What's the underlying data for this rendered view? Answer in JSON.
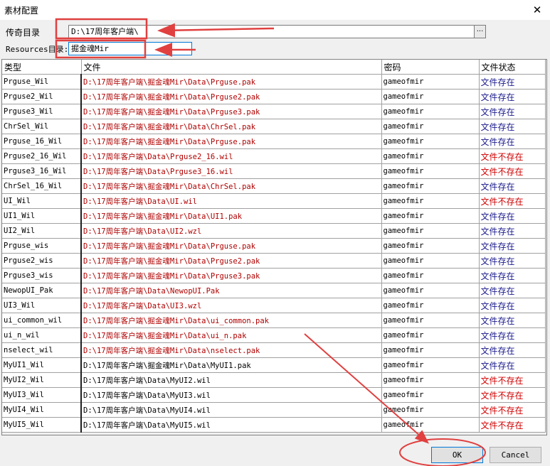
{
  "window": {
    "title": "素材配置",
    "close_label": "✕"
  },
  "form": {
    "legend_dir_label": "传奇目录",
    "legend_dir_value": "D:\\17周年客户端\\",
    "browse_label": "...",
    "resources_dir_label": "Resources目录:",
    "resources_dir_value": "掘金魂Mir"
  },
  "table": {
    "columns": [
      "类型",
      "文件",
      "密码",
      "文件状态"
    ],
    "rows": [
      {
        "type": "Prguse_Wil",
        "file": "D:\\17周年客户端\\掘金魂Mir\\Data\\Prguse.pak",
        "password": "gameofmir",
        "status": "文件存在",
        "file_color": "red",
        "status_ok": true
      },
      {
        "type": "Prguse2_Wil",
        "file": "D:\\17周年客户端\\掘金魂Mir\\Data\\Prguse2.pak",
        "password": "gameofmir",
        "status": "文件存在",
        "file_color": "red",
        "status_ok": true
      },
      {
        "type": "Prguse3_Wil",
        "file": "D:\\17周年客户端\\掘金魂Mir\\Data\\Prguse3.pak",
        "password": "gameofmir",
        "status": "文件存在",
        "file_color": "red",
        "status_ok": true
      },
      {
        "type": "ChrSel_Wil",
        "file": "D:\\17周年客户端\\掘金魂Mir\\Data\\ChrSel.pak",
        "password": "gameofmir",
        "status": "文件存在",
        "file_color": "red",
        "status_ok": true
      },
      {
        "type": "Prguse_16_Wil",
        "file": "D:\\17周年客户端\\掘金魂Mir\\Data\\Prguse.pak",
        "password": "gameofmir",
        "status": "文件存在",
        "file_color": "red",
        "status_ok": true
      },
      {
        "type": "Prguse2_16_Wil",
        "file": "D:\\17周年客户端\\Data\\Prguse2_16.wil",
        "password": "gameofmir",
        "status": "文件不存在",
        "file_color": "red",
        "status_ok": false
      },
      {
        "type": "Prguse3_16_Wil",
        "file": "D:\\17周年客户端\\Data\\Prguse3_16.wil",
        "password": "gameofmir",
        "status": "文件不存在",
        "file_color": "red",
        "status_ok": false
      },
      {
        "type": "ChrSel_16_Wil",
        "file": "D:\\17周年客户端\\掘金魂Mir\\Data\\ChrSel.pak",
        "password": "gameofmir",
        "status": "文件存在",
        "file_color": "red",
        "status_ok": true
      },
      {
        "type": "UI_Wil",
        "file": "D:\\17周年客户端\\Data\\UI.wil",
        "password": "gameofmir",
        "status": "文件不存在",
        "file_color": "red",
        "status_ok": false
      },
      {
        "type": "UI1_Wil",
        "file": "D:\\17周年客户端\\掘金魂Mir\\Data\\UI1.pak",
        "password": "gameofmir",
        "status": "文件存在",
        "file_color": "red",
        "status_ok": true
      },
      {
        "type": "UI2_Wil",
        "file": "D:\\17周年客户端\\Data\\UI2.wzl",
        "password": "gameofmir",
        "status": "文件存在",
        "file_color": "red",
        "status_ok": true
      },
      {
        "type": "Prguse_wis",
        "file": "D:\\17周年客户端\\掘金魂Mir\\Data\\Prguse.pak",
        "password": "gameofmir",
        "status": "文件存在",
        "file_color": "red",
        "status_ok": true
      },
      {
        "type": "Prguse2_wis",
        "file": "D:\\17周年客户端\\掘金魂Mir\\Data\\Prguse2.pak",
        "password": "gameofmir",
        "status": "文件存在",
        "file_color": "red",
        "status_ok": true
      },
      {
        "type": "Prguse3_wis",
        "file": "D:\\17周年客户端\\掘金魂Mir\\Data\\Prguse3.pak",
        "password": "gameofmir",
        "status": "文件存在",
        "file_color": "red",
        "status_ok": true
      },
      {
        "type": "NewopUI_Pak",
        "file": "D:\\17周年客户端\\Data\\NewopUI.Pak",
        "password": "gameofmir",
        "status": "文件存在",
        "file_color": "red",
        "status_ok": true
      },
      {
        "type": "UI3_Wil",
        "file": "D:\\17周年客户端\\Data\\UI3.wzl",
        "password": "gameofmir",
        "status": "文件存在",
        "file_color": "red",
        "status_ok": true
      },
      {
        "type": "ui_common_wil",
        "file": "D:\\17周年客户端\\掘金魂Mir\\Data\\ui_common.pak",
        "password": "gameofmir",
        "status": "文件存在",
        "file_color": "red",
        "status_ok": true
      },
      {
        "type": "ui_n_wil",
        "file": "D:\\17周年客户端\\掘金魂Mir\\Data\\ui_n.pak",
        "password": "gameofmir",
        "status": "文件存在",
        "file_color": "red",
        "status_ok": true
      },
      {
        "type": "nselect_wil",
        "file": "D:\\17周年客户端\\掘金魂Mir\\Data\\nselect.pak",
        "password": "gameofmir",
        "status": "文件存在",
        "file_color": "red",
        "status_ok": true
      },
      {
        "type": "MyUI1_Wil",
        "file": "D:\\17周年客户端\\掘金魂Mir\\Data\\MyUI1.pak",
        "password": "gameofmir",
        "status": "文件存在",
        "file_color": "black",
        "status_ok": true
      },
      {
        "type": "MyUI2_Wil",
        "file": "D:\\17周年客户端\\Data\\MyUI2.wil",
        "password": "gameofmir",
        "status": "文件不存在",
        "file_color": "black",
        "status_ok": false
      },
      {
        "type": "MyUI3_Wil",
        "file": "D:\\17周年客户端\\Data\\MyUI3.wil",
        "password": "gameofmir",
        "status": "文件不存在",
        "file_color": "black",
        "status_ok": false
      },
      {
        "type": "MyUI4_Wil",
        "file": "D:\\17周年客户端\\Data\\MyUI4.wil",
        "password": "gameofmir",
        "status": "文件不存在",
        "file_color": "black",
        "status_ok": false
      },
      {
        "type": "MyUI5_Wil",
        "file": "D:\\17周年客户端\\Data\\MyUI5.wil",
        "password": "gameofmir",
        "status": "文件不存在",
        "file_color": "black",
        "status_ok": false
      }
    ]
  },
  "buttons": {
    "ok_label": "OK",
    "cancel_label": "Cancel"
  },
  "colors": {
    "annotation_red": "#e04040",
    "status_ok": "#1a1a8c",
    "status_bad": "#d00000",
    "path_red": "#b00000"
  }
}
